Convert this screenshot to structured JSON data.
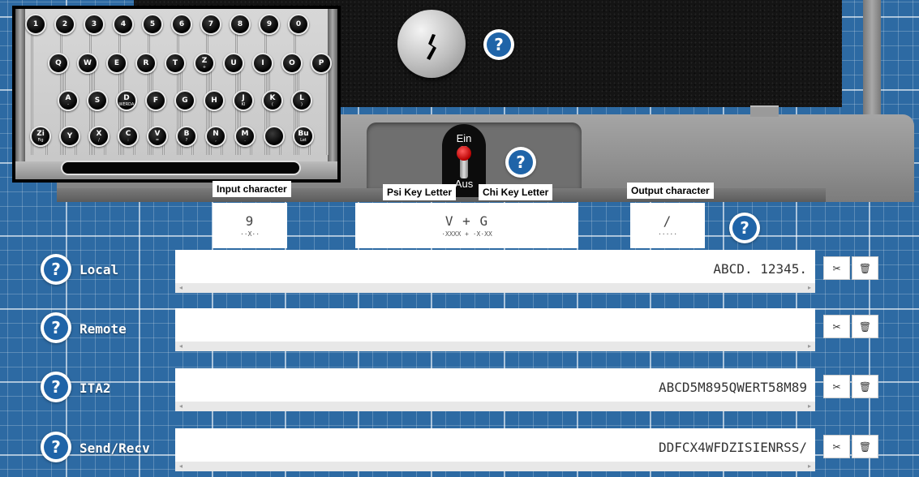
{
  "machine": {
    "switch": {
      "on_label": "Ein",
      "off_label": "Aus"
    },
    "help_glyph": "?",
    "keyboard": {
      "rows": [
        [
          {
            "main": "1"
          },
          {
            "main": "2"
          },
          {
            "main": "3"
          },
          {
            "main": "4"
          },
          {
            "main": "5"
          },
          {
            "main": "6"
          },
          {
            "main": "7"
          },
          {
            "main": "8"
          },
          {
            "main": "9"
          },
          {
            "main": "0"
          }
        ],
        [
          {
            "main": "Q"
          },
          {
            "main": "W"
          },
          {
            "main": "E"
          },
          {
            "main": "R"
          },
          {
            "main": "T"
          },
          {
            "main": "Z",
            "sub": "+"
          },
          {
            "main": "U"
          },
          {
            "main": "I"
          },
          {
            "main": "O"
          },
          {
            "main": "P"
          }
        ],
        [
          {
            "main": "A",
            "sub": "-"
          },
          {
            "main": "S"
          },
          {
            "main": "D",
            "sub": "WERDA"
          },
          {
            "main": "F"
          },
          {
            "main": "G"
          },
          {
            "main": "H"
          },
          {
            "main": "J",
            "sub": "Kl"
          },
          {
            "main": "K",
            "sub": "("
          },
          {
            "main": "L",
            "sub": ")"
          }
        ],
        [
          {
            "main": "Zi",
            "sub": "Fig"
          },
          {
            "main": "Y"
          },
          {
            "main": "X",
            "sub": "/"
          },
          {
            "main": "C",
            "sub": ":"
          },
          {
            "main": "V",
            "sub": "="
          },
          {
            "main": "B",
            "sub": "?"
          },
          {
            "main": "N",
            "sub": ","
          },
          {
            "main": "M",
            "sub": "."
          },
          {
            "main": ""
          },
          {
            "main": "Bu",
            "sub": "Let"
          }
        ]
      ]
    }
  },
  "labels": {
    "input_character": "Input character",
    "psi_key_letter": "Psi Key Letter",
    "chi_key_letter": "Chi Key Letter",
    "output_character": "Output character"
  },
  "displays": {
    "input": {
      "char": "9",
      "code": "··X··"
    },
    "key": {
      "char": "V + G",
      "code": "·XXXX + ·X·XX"
    },
    "output": {
      "char": "/",
      "code": "·····"
    }
  },
  "tapes": [
    {
      "label": "Local",
      "value": "ABCD. 12345."
    },
    {
      "label": "Remote",
      "value": ""
    },
    {
      "label": "ITA2",
      "value": "ABCD5M895QWERT58M89"
    },
    {
      "label": "Send/Recv",
      "value": "DDFCX4WFDZISIENRSS/"
    }
  ],
  "tools": {
    "cut_glyph": "✂",
    "delete_glyph": "🗑"
  },
  "scroll_arrows": {
    "left": "◂",
    "right": "▸"
  }
}
